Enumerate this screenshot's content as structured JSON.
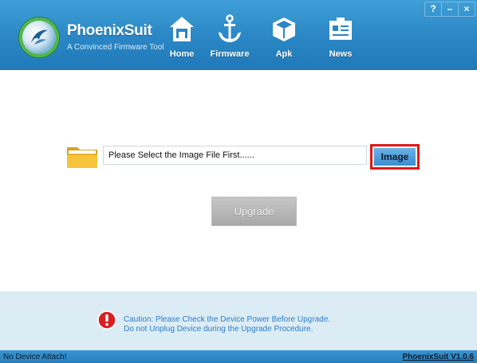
{
  "app": {
    "name": "PhoenixSuit",
    "subtitle": "A Convinced Firmware Tool"
  },
  "nav": {
    "items": [
      {
        "label": "Home",
        "icon": "home-icon"
      },
      {
        "label": "Firmware",
        "icon": "anchor-icon"
      },
      {
        "label": "Apk",
        "icon": "package-icon"
      },
      {
        "label": "News",
        "icon": "news-icon"
      }
    ]
  },
  "window_controls": {
    "help": "?",
    "minimize": "–",
    "close": "×"
  },
  "firmware": {
    "path_text": "Please Select the Image File First......",
    "image_button": "Image",
    "upgrade_button": "Upgrade"
  },
  "caution": {
    "line1": "Caution: Please Check the Device Power Before Upgrade.",
    "line2": "Do not Unplug Device during the Upgrade Procedure."
  },
  "status": {
    "device": "No Device Attach!",
    "version": "PhoenixSuit V1.0.6"
  },
  "colors": {
    "header": "#2a86c4",
    "highlight": "#e01818",
    "caution_text": "#2c7cc9"
  }
}
